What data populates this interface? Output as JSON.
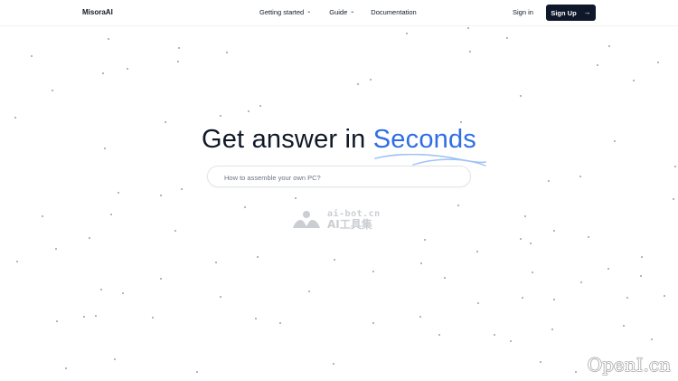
{
  "header": {
    "brand": "MisoraAI",
    "nav": [
      {
        "label": "Getting started",
        "icon": "chevron-down-icon"
      },
      {
        "label": "Guide",
        "icon": "chevron-down-icon"
      },
      {
        "label": "Documentation"
      }
    ],
    "signin_label": "Sign in",
    "signup_label": "Sign Up",
    "signup_icon": "arrow-right-icon"
  },
  "hero": {
    "title_prefix": "Get answer in ",
    "title_accent": "Seconds",
    "accent_color": "#2f6ee5"
  },
  "search": {
    "placeholder": "How to assemble your own PC?",
    "value": ""
  },
  "watermark": {
    "line1": "ai-bot.cn",
    "line2": "AI工具集"
  },
  "corner_watermark": "OpenI.cn"
}
